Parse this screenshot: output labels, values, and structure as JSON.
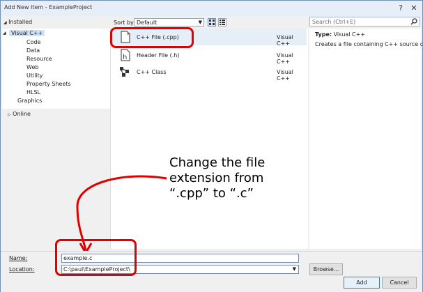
{
  "window": {
    "title": "Add New Item - ExampleProject",
    "help_glyph": "?",
    "close_glyph": "✕"
  },
  "left_tree": {
    "installed": "Installed",
    "root": "Visual C++",
    "children": [
      "Code",
      "Data",
      "Resource",
      "Web",
      "Utility",
      "Property Sheets",
      "HLSL"
    ],
    "graphics": "Graphics",
    "online": "Online"
  },
  "toolbar": {
    "sort_label": "Sort by:",
    "sort_value": "Default",
    "search_placeholder": "Search (Ctrl+E)"
  },
  "templates": [
    {
      "name": "C++ File (.cpp)",
      "lang": "Visual C++",
      "icon": "cpp-file-icon"
    },
    {
      "name": "Header File (.h)",
      "lang": "Visual C++",
      "icon": "header-file-icon"
    },
    {
      "name": "C++ Class",
      "lang": "Visual C++",
      "icon": "cpp-class-icon"
    }
  ],
  "details": {
    "type_label": "Type:",
    "type_value": "Visual C++",
    "description": "Creates a file containing C++ source code"
  },
  "form": {
    "name_label": "Name:",
    "name_value": "example.c",
    "location_label": "Location:",
    "location_value": "C:\\paul\\ExampleProject\\",
    "browse_label": "Browse...",
    "add_label": "Add",
    "cancel_label": "Cancel"
  },
  "annotation": {
    "line1": "Change the file",
    "line2": "extension from",
    "line3": "“.cpp” to “.c”"
  },
  "colors": {
    "highlight_red": "#e00000",
    "selection_blue": "#cfe3f7"
  }
}
